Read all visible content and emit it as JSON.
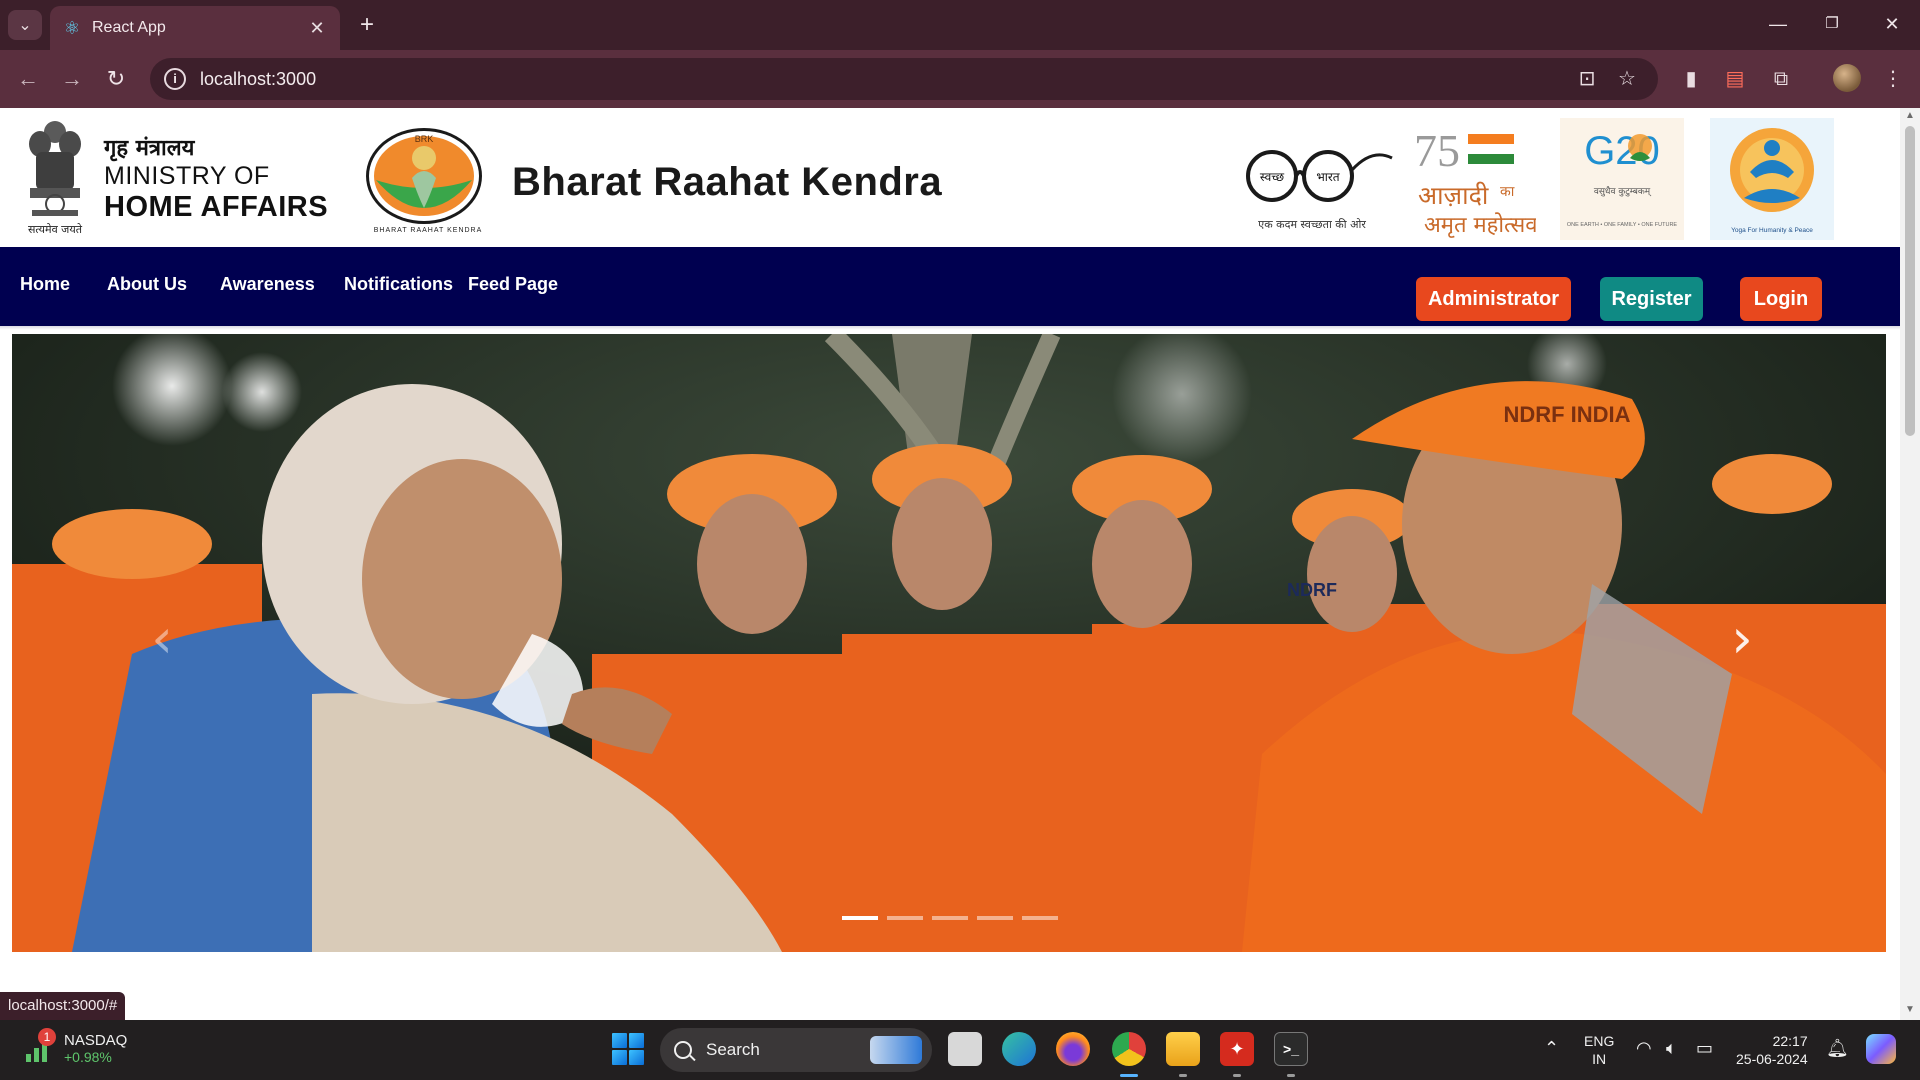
{
  "browser": {
    "tab_title": "React App",
    "url": "localhost:3000",
    "status_url": "localhost:3000/#"
  },
  "header": {
    "ministry_hindi": "गृह मंत्रालय",
    "ministry_line1": "MINISTRY OF",
    "ministry_line2": "HOME AFFAIRS",
    "emblem_motto": "सत्यमेव जयते",
    "brk_logo_text": "BRK",
    "brk_logo_caption": "BHARAT RAAHAT KENDRA",
    "site_title": "Bharat Raahat Kendra",
    "partners": {
      "swachh_left": "स्वच्छ",
      "swachh_right": "भारत",
      "swachh_caption": "एक कदम स्वच्छता की ओर",
      "azadi_number": "75",
      "azadi_line1": "आज़ादी",
      "azadi_ka": "का",
      "azadi_line2": "अमृत महोत्सव",
      "g20_label": "G20",
      "g20_sub": "वसुधैव कुटुम्बकम्",
      "g20_motto": "ONE EARTH • ONE FAMILY • ONE FUTURE",
      "yoga_label": "Yoga For Humanity & Peace"
    }
  },
  "nav": {
    "links": [
      "Home",
      "About Us",
      "Awareness",
      "Notifications",
      "Feed Page"
    ],
    "buttons": {
      "admin": "Administrator",
      "register": "Register",
      "login": "Login"
    }
  },
  "carousel": {
    "slide_count": 5,
    "active_index": 0,
    "prev_glyph": "‹",
    "next_glyph": "›",
    "photo_cap_text": "NDRF INDIA",
    "photo_jacket_text": "NDRF"
  },
  "taskbar": {
    "stock_name": "NASDAQ",
    "stock_change": "+0.98%",
    "stock_badge": "1",
    "search_placeholder": "Search",
    "lang_line1": "ENG",
    "lang_line2": "IN",
    "time": "22:17",
    "date": "25-06-2024"
  },
  "colors": {
    "navbar": "#000050",
    "accent_orange": "#e8481e",
    "accent_teal": "#0f8a84",
    "browser_frame": "#3c1f2a"
  }
}
